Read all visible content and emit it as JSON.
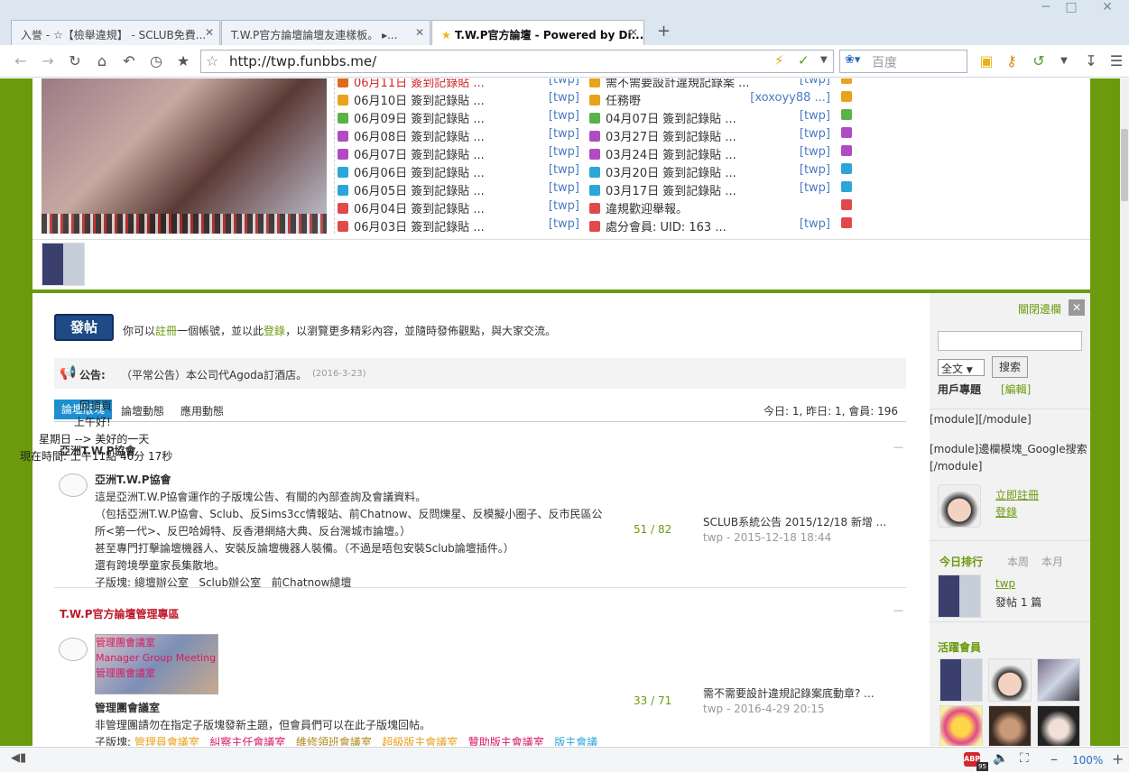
{
  "tabs": [
    {
      "label": "入誉 - ☆【檢舉違規】 - SCLUB免費..."
    },
    {
      "label": "T.W.P官方論壇論壇友連樣板。 ▸..."
    },
    {
      "label": "T.W.P官方論壇 - Powered by Di..."
    }
  ],
  "browser": {
    "url": "http://twp.funbbs.me/",
    "search_placeholder": "百度",
    "zoom": "100%",
    "badge_count": "95"
  },
  "list_left": [
    {
      "text": "06月11日 簽到記錄貼 ...",
      "tag": "[twp]",
      "color": "#e06a1a",
      "red": true
    },
    {
      "text": "06月10日 簽到記錄貼 ...",
      "tag": "[twp]",
      "color": "#e9a21b"
    },
    {
      "text": "06月09日 簽到記錄貼 ...",
      "tag": "[twp]",
      "color": "#5bb14a"
    },
    {
      "text": "06月08日 簽到記錄貼 ...",
      "tag": "[twp]",
      "color": "#b04bc4"
    },
    {
      "text": "06月07日 簽到記錄貼 ...",
      "tag": "[twp]",
      "color": "#b04bc4"
    },
    {
      "text": "06月06日 簽到記錄貼 ...",
      "tag": "[twp]",
      "color": "#2aa6d8"
    },
    {
      "text": "06月05日 簽到記錄貼 ...",
      "tag": "[twp]",
      "color": "#2aa6d8"
    },
    {
      "text": "06月04日 簽到記錄貼 ...",
      "tag": "[twp]",
      "color": "#e04a4a"
    },
    {
      "text": "06月03日 簽到記錄貼 ...",
      "tag": "[twp]",
      "color": "#e04a4a"
    }
  ],
  "list_right": [
    {
      "text": "需不需要設計違規記錄案 ...",
      "tag": "[twp]",
      "color": "#e9a21b"
    },
    {
      "text": "任務嘢",
      "tag": "[xoxoyy88 ...]",
      "color": "#e9a21b"
    },
    {
      "text": "04月07日 簽到記錄貼 ...",
      "tag": "[twp]",
      "color": "#5bb14a"
    },
    {
      "text": "03月27日 簽到記錄貼 ...",
      "tag": "[twp]",
      "color": "#b04bc4"
    },
    {
      "text": "03月24日 簽到記錄貼 ...",
      "tag": "[twp]",
      "color": "#b04bc4"
    },
    {
      "text": "03月20日 簽到記錄貼 ...",
      "tag": "[twp]",
      "color": "#2aa6d8"
    },
    {
      "text": "03月17日 簽到記錄貼 ...",
      "tag": "[twp]",
      "color": "#2aa6d8"
    },
    {
      "text": "違規歡迎舉報。",
      "tag": "",
      "color": "#e04a4a"
    },
    {
      "text": "處分會員: UID: 163 ...",
      "tag": "[twp]",
      "color": "#e04a4a"
    }
  ],
  "post": {
    "button": "發帖",
    "msg_pre": "你可以",
    "msg_register": "註冊",
    "msg_mid": "一個帳號，並以此",
    "msg_login": "登錄",
    "msg_post": "，以瀏覽更多精彩內容，並隨時發佈觀點，與大家交流。"
  },
  "announce": {
    "label": "公告:",
    "text": "（平常公告）本公司代Agoda訂酒店。",
    "date": "(2016-3-23)"
  },
  "nav": {
    "tabs": [
      "論壇版塊",
      "論壇動態",
      "應用動態"
    ],
    "stats": "今日: 1, 昨日: 1, 會員: 196"
  },
  "overlay": {
    "line1": "回頂頁",
    "line2": "上午好!",
    "line3": "星期日 --> 美好的一天",
    "line4": "現在時間: 上午11點 46分 17秒"
  },
  "section1": {
    "title": "亞洲T.W.P協會",
    "forum_name": "亞洲T.W.P協會",
    "desc1": "這是亞洲T.W.P協會運作的子版塊公告、有關的內部查詢及會議資料。",
    "desc2": "（包括亞洲T.W.P協會、Sclub、反Sims3cc情報站、前Chatnow、反問爍星、反模擬小圈子、反市民區公",
    "desc3": "所<第一代>、反巴哈姆特、反香港網絡大典、反台灣城市論壇。）",
    "desc4": "甚至專門打擊論壇機器人、安裝反論壇機器人裝備。（不過是唔包安裝Sclub論壇插件。）",
    "desc5": "還有跨境學童家長集散地。",
    "sub_label": "子版塊:",
    "subs": [
      "總壇辦公室",
      "Sclub辦公室",
      "前Chatnow總壇"
    ],
    "counts": "51 / 82",
    "last_title": "SCLUB系統公告 2015/12/18 新增 ...",
    "last_meta": "twp - 2015-12-18 18:44"
  },
  "section2": {
    "title": "T.W.P官方論壇管理專區",
    "thumb_text1": "管理團會議室",
    "thumb_text2": "Manager Group Meeting",
    "thumb_text3": "管理團會議室",
    "forum_name": "管理團會議室",
    "desc1": "非管理團請勿在指定子版塊發新主題，但會員們可以在此子版塊回帖。",
    "sub_label": "子版塊:",
    "subs": [
      "管理員會議室",
      "糾察主任會議室",
      "維修領班會議室",
      "超級版主會議室",
      "贊助版主會議室",
      "版主會議"
    ],
    "counts": "33 / 71",
    "last_title": "需不需要設計違規記錄案底動章? ...",
    "last_meta": "twp - 2016-4-29 20:15"
  },
  "sidebar": {
    "close_label": "關閉邊欄",
    "search_option": "全文",
    "search_button": "搜索",
    "user_label": "用戶專題",
    "edit_label": "[編輯]",
    "module1": "[module][/module]",
    "module2": "[module]邊欄模塊_Google搜索[/module]",
    "register": "立即註冊",
    "login": "登錄",
    "rank_tabs": [
      "今日排行",
      "本周",
      "本月"
    ],
    "rank_user": "twp",
    "rank_posts": "發帖 1 篇",
    "active_label": "活躍會員"
  }
}
